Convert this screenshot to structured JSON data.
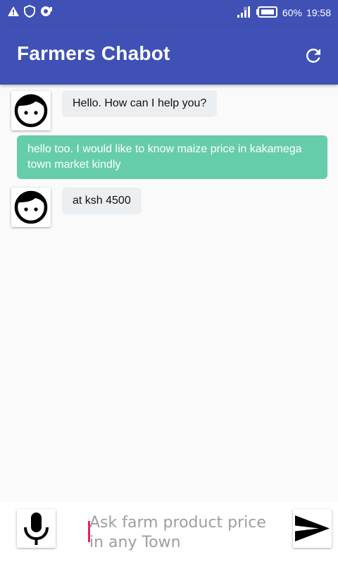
{
  "status_bar": {
    "battery": "60%",
    "time": "19:58",
    "icons": [
      "warning-icon",
      "shield-icon",
      "chat-notification-icon",
      "signal-icon",
      "battery-icon"
    ]
  },
  "app_bar": {
    "title": "Farmers Chabot",
    "action_icon": "refresh-icon"
  },
  "messages": [
    {
      "sender": "bot",
      "text": "Hello. How can I help you?"
    },
    {
      "sender": "user",
      "text": "hello too. I would like to know maize price in kakamega town market kindly"
    },
    {
      "sender": "bot",
      "text": "at ksh 4500"
    }
  ],
  "input": {
    "value": "",
    "placeholder": "Ask farm product price in any Town",
    "mic_icon": "microphone-icon",
    "send_icon": "send-icon"
  },
  "colors": {
    "primary": "#3f51b5",
    "user_bubble": "#66cdaa",
    "bot_bubble": "#eceff1",
    "background": "#fafafa",
    "cursor": "#e91e63"
  }
}
